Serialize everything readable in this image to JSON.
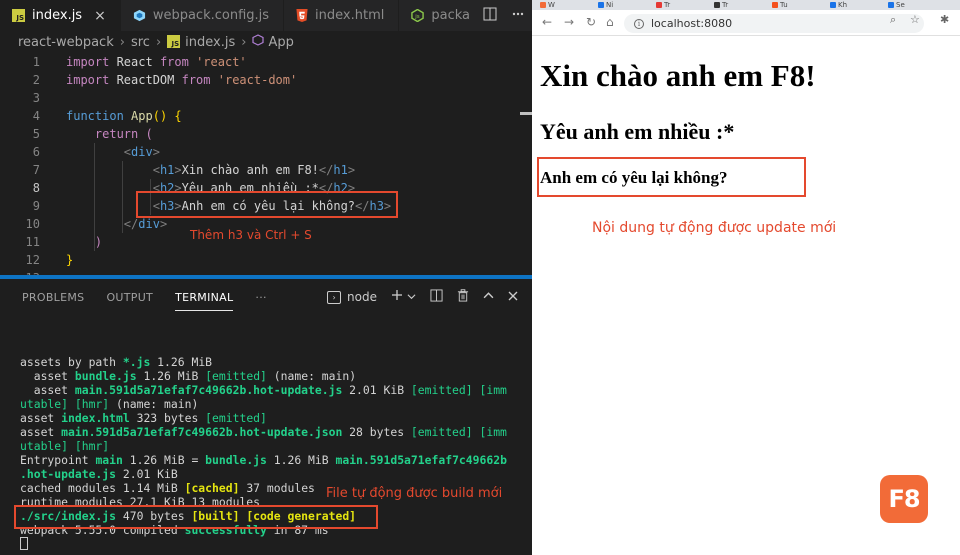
{
  "editor": {
    "tabs": [
      {
        "label": "index.js",
        "icon": "js-icon",
        "active": true
      },
      {
        "label": "webpack.config.js",
        "icon": "webpack-icon"
      },
      {
        "label": "index.html",
        "icon": "html5-icon"
      },
      {
        "label": "packa",
        "icon": "nodejs-icon"
      }
    ],
    "tab_close": "×",
    "breadcrumb": [
      "react-webpack",
      "src",
      "index.js",
      "App"
    ],
    "code_lines": [
      {
        "n": "1",
        "parts": [
          [
            "kw2",
            "import"
          ],
          [
            "txt",
            " React "
          ],
          [
            "kw2",
            "from"
          ],
          [
            "txt",
            " "
          ],
          [
            "str",
            "'react'"
          ]
        ]
      },
      {
        "n": "2",
        "parts": [
          [
            "kw2",
            "import"
          ],
          [
            "txt",
            " ReactDOM "
          ],
          [
            "kw2",
            "from"
          ],
          [
            "txt",
            " "
          ],
          [
            "str",
            "'react-dom'"
          ]
        ]
      },
      {
        "n": "3",
        "parts": []
      },
      {
        "n": "4",
        "parts": [
          [
            "kw",
            "function"
          ],
          [
            "txt",
            " "
          ],
          [
            "fn",
            "App"
          ],
          [
            "bracey",
            "() {"
          ]
        ]
      },
      {
        "n": "5",
        "parts": [
          [
            "txt",
            "    "
          ],
          [
            "kw2",
            "return"
          ],
          [
            "txt",
            " "
          ],
          [
            "kw2",
            "("
          ]
        ]
      },
      {
        "n": "6",
        "parts": [
          [
            "txt",
            "        "
          ],
          [
            "brk",
            "<"
          ],
          [
            "tag",
            "div"
          ],
          [
            "brk",
            ">"
          ]
        ]
      },
      {
        "n": "7",
        "parts": [
          [
            "txt",
            "            "
          ],
          [
            "brk",
            "<"
          ],
          [
            "tag",
            "h1"
          ],
          [
            "brk",
            ">"
          ],
          [
            "txt",
            "Xin chào anh em F8!"
          ],
          [
            "brk",
            "</"
          ],
          [
            "tag",
            "h1"
          ],
          [
            "brk",
            ">"
          ]
        ]
      },
      {
        "n": "8",
        "parts": [
          [
            "txt",
            "            "
          ],
          [
            "brk",
            "<"
          ],
          [
            "tag",
            "h2"
          ],
          [
            "brk",
            ">"
          ],
          [
            "txt",
            "Yêu anh em nhiều :*"
          ],
          [
            "brk",
            "</"
          ],
          [
            "tag",
            "h2"
          ],
          [
            "brk",
            ">"
          ]
        ]
      },
      {
        "n": "9",
        "parts": [
          [
            "txt",
            "            "
          ],
          [
            "brk",
            "<"
          ],
          [
            "tag",
            "h3"
          ],
          [
            "brk",
            ">"
          ],
          [
            "txt",
            "Anh em có yêu lại không?"
          ],
          [
            "brk",
            "</"
          ],
          [
            "tag",
            "h3"
          ],
          [
            "brk",
            ">"
          ]
        ]
      },
      {
        "n": "10",
        "parts": [
          [
            "txt",
            "        "
          ],
          [
            "brk",
            "</"
          ],
          [
            "tag",
            "div"
          ],
          [
            "brk",
            ">"
          ]
        ]
      },
      {
        "n": "11",
        "parts": [
          [
            "txt",
            "    "
          ],
          [
            "kw2",
            ")"
          ]
        ]
      },
      {
        "n": "12",
        "parts": [
          [
            "bracey",
            "}"
          ]
        ]
      },
      {
        "n": "13",
        "parts": []
      }
    ],
    "current_line": "8",
    "code_annotation": "Thêm h3 và Ctrl + S"
  },
  "panel": {
    "tabs": [
      "PROBLEMS",
      "OUTPUT",
      "TERMINAL",
      "···"
    ],
    "active_tab": "TERMINAL",
    "terminal_selector": "node",
    "terminal_lines": [
      [
        [
          "txt",
          "assets by path "
        ],
        [
          "g",
          "*.js"
        ],
        [
          "txt",
          " 1.26 MiB"
        ]
      ],
      [
        [
          "txt",
          "  asset "
        ],
        [
          "g",
          "bundle.js"
        ],
        [
          "txt",
          " 1.26 MiB "
        ],
        [
          "gp",
          "[emitted]"
        ],
        [
          "txt",
          " (name: main)"
        ]
      ],
      [
        [
          "txt",
          "  asset "
        ],
        [
          "g",
          "main.591d5a71efaf7c49662b.hot-update.js"
        ],
        [
          "txt",
          " 2.01 KiB "
        ],
        [
          "gp",
          "[emitted] [imm"
        ]
      ],
      [
        [
          "gp",
          "utable] [hmr]"
        ],
        [
          "txt",
          " (name: main)"
        ]
      ],
      [
        [
          "txt",
          "asset "
        ],
        [
          "g",
          "index.html"
        ],
        [
          "txt",
          " 323 bytes "
        ],
        [
          "gp",
          "[emitted]"
        ]
      ],
      [
        [
          "txt",
          "asset "
        ],
        [
          "g",
          "main.591d5a71efaf7c49662b.hot-update.json"
        ],
        [
          "txt",
          " 28 bytes "
        ],
        [
          "gp",
          "[emitted] [imm"
        ]
      ],
      [
        [
          "gp",
          "utable] [hmr]"
        ]
      ],
      [
        [
          "txt",
          "Entrypoint "
        ],
        [
          "g",
          "main"
        ],
        [
          "txt",
          " 1.26 MiB = "
        ],
        [
          "g",
          "bundle.js"
        ],
        [
          "txt",
          " 1.26 MiB "
        ],
        [
          "g",
          "main.591d5a71efaf7c49662b"
        ]
      ],
      [
        [
          "g",
          ".hot-update.js"
        ],
        [
          "txt",
          " 2.01 KiB"
        ]
      ],
      [
        [
          "txt",
          "cached modules 1.14 MiB "
        ],
        [
          "y",
          "[cached]"
        ],
        [
          "txt",
          " 37 modules"
        ]
      ],
      [
        [
          "txt",
          "runtime modules 27.1 KiB 13 modules"
        ]
      ],
      [
        [
          "g",
          "./src/index.js"
        ],
        [
          "txt",
          " 470 bytes "
        ],
        [
          "y",
          "[built] [code generated]"
        ]
      ],
      [
        [
          "txt",
          "webpack 5.55.0 compiled "
        ],
        [
          "g",
          "successfully"
        ],
        [
          "txt",
          " in 87 ms"
        ]
      ]
    ],
    "terminal_annotation": "File tự động được build mới"
  },
  "browser": {
    "url": "localhost:8080",
    "tab_titles": [
      "W",
      "Ni",
      "Tr",
      "Tr",
      "Tu",
      "Kh",
      "Se"
    ],
    "h1": "Xin chào anh em F8!",
    "h2": "Yêu anh em nhiều :*",
    "h3": "Anh em có yêu lại không?",
    "annotation": "Nội dung tự động được update mới"
  },
  "logo": "F8",
  "colors": {
    "annotation_red": "#e4492e",
    "editor_bg": "#1e1e1e",
    "accent_blue": "#0e74c4",
    "logo_orange": "#f26b38"
  }
}
